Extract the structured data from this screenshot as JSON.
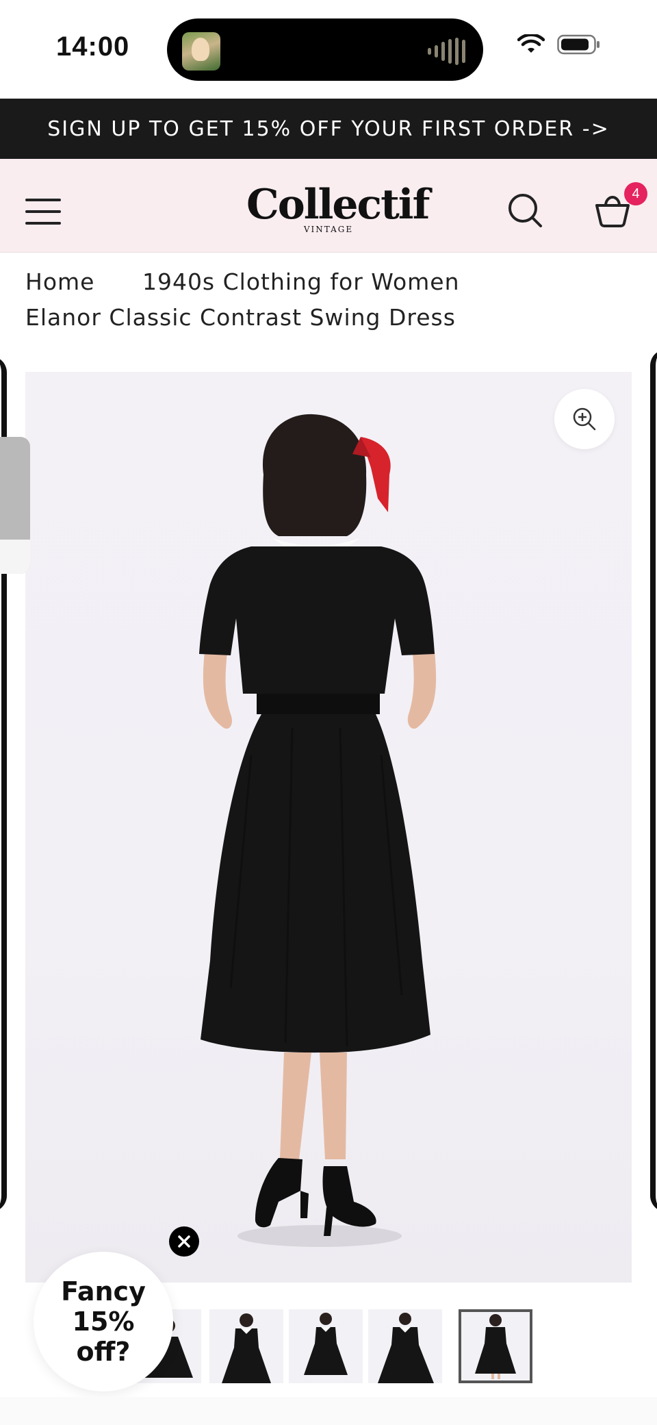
{
  "status_bar": {
    "time": "14:00"
  },
  "promo": {
    "text": "SIGN UP TO GET 15% OFF YOUR FIRST ORDER ->"
  },
  "header": {
    "logo_text": "Collectif",
    "logo_subtext": "VINTAGE",
    "cart_count": "4"
  },
  "breadcrumb": {
    "home": "Home",
    "category": "1940s Clothing for Women",
    "current": "Elanor Classic Contrast Swing Dress"
  },
  "product": {
    "thumbnail_count": 6,
    "active_thumbnail": 5
  },
  "popup": {
    "fancy_text": "Fancy 15% off?"
  },
  "colors": {
    "promo_bg": "#1a1a1a",
    "header_bg": "#f9edf0",
    "badge": "#e5235f",
    "dress": "#151515",
    "bow": "#e32630"
  }
}
